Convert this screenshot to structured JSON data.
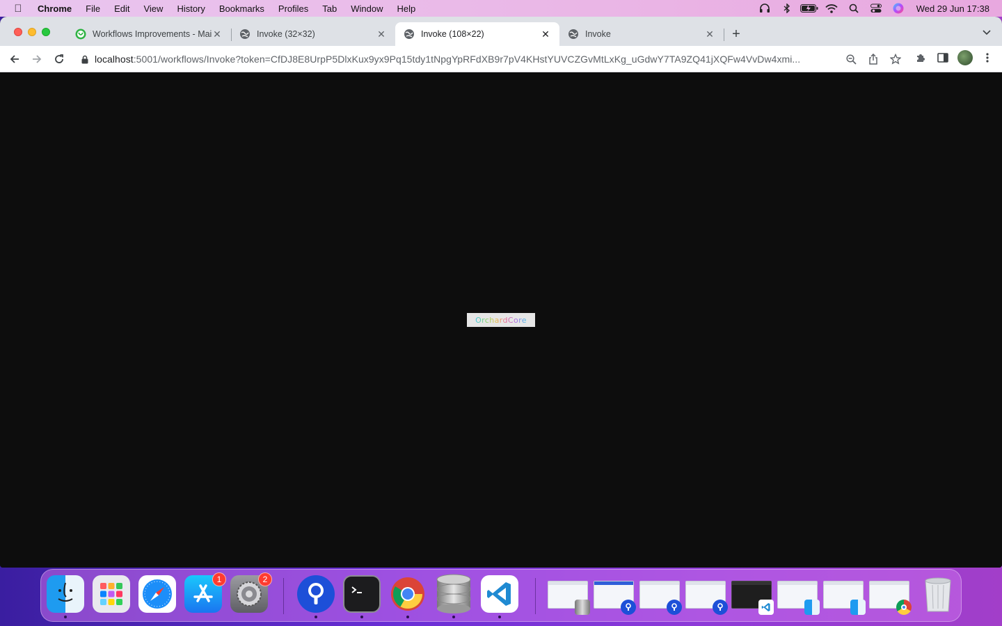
{
  "menubar": {
    "app_name": "Chrome",
    "items": [
      "File",
      "Edit",
      "View",
      "History",
      "Bookmarks",
      "Profiles",
      "Tab",
      "Window",
      "Help"
    ],
    "clock": "Wed 29 Jun  17:38"
  },
  "tabs": [
    {
      "title": "Workflows Improvements - Mai",
      "icon": "app-logo-icon",
      "active": false
    },
    {
      "title": "Invoke (32×32)",
      "icon": "globe-icon",
      "active": false
    },
    {
      "title": "Invoke (108×22)",
      "icon": "globe-icon",
      "active": true
    },
    {
      "title": "Invoke",
      "icon": "globe-icon",
      "active": false
    }
  ],
  "toolbar": {
    "url_host": "localhost",
    "url_rest": ":5001/workflows/Invoke?token=CfDJ8E8UrpP5DlxKux9yx9Pq15tdy1tNpgYpRFdXB9r7pV4KHstYUVCZGvMtLxKg_uGdwY7TA9ZQ41jXQFw4VvDw4xmi..."
  },
  "viewport": {
    "background": "#0d0d0d",
    "image_text": "OrchardCore"
  },
  "dock": {
    "apps": [
      {
        "name": "finder",
        "badge": ""
      },
      {
        "name": "launchpad",
        "badge": ""
      },
      {
        "name": "safari",
        "badge": ""
      },
      {
        "name": "app-store",
        "badge": "1"
      },
      {
        "name": "system-preferences",
        "badge": "2"
      },
      {
        "name": "sourcetree",
        "badge": ""
      },
      {
        "name": "terminal",
        "badge": ""
      },
      {
        "name": "chrome",
        "badge": ""
      },
      {
        "name": "database",
        "badge": ""
      },
      {
        "name": "vscode",
        "badge": ""
      }
    ]
  },
  "colors": {
    "tab_strip": "#dee1e6",
    "accent_red": "#ff5f57",
    "accent_yellow": "#febc2e",
    "accent_green": "#28c840"
  }
}
